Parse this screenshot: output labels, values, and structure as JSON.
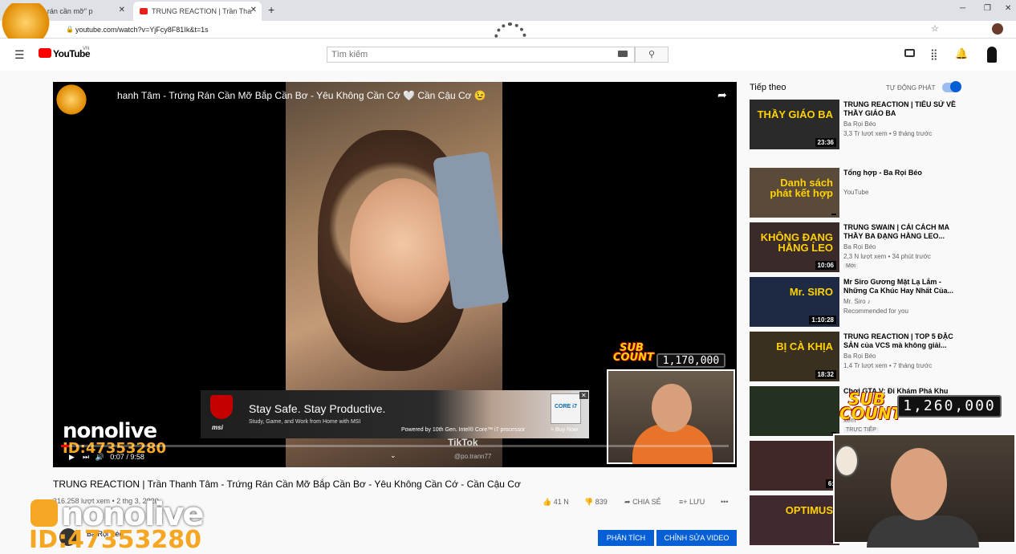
{
  "browser": {
    "tabs": [
      {
        "label": "\"Trứng rán cần mỡ\" p"
      },
      {
        "label": "TRUNG REACTION | Trần Tha"
      }
    ],
    "new_tab": "+",
    "url": "youtube.com/watch?v=YjFcy8F81Ik&t=1s",
    "window_controls": [
      "─",
      "❐",
      "✕"
    ]
  },
  "youtube": {
    "logo": "YouTube",
    "region": "VN",
    "search_placeholder": "Tìm kiếm"
  },
  "video": {
    "overlay_title": "hanh Tâm - Trứng Rán Cần Mỡ Bắp Cần Bơ - Yêu Không Cần Cớ 🤍 Cần Cậu Cơ 😉",
    "time": "0:07 / 9:58",
    "progress_fraction": 0.012,
    "watermark": "@po.trann77",
    "tiktok": "TikTok",
    "nonolive": "nonolive",
    "nonolive_id": "ID:47353280",
    "sub_count_label": "SUB COUNT",
    "sub_count_1": "1,170,000",
    "sub_count_2": "1,260,000",
    "ad": {
      "brand": "msi",
      "headline": "Stay Safe. Stay Productive.",
      "sub": "Study, Game, and Work from Home with MSI",
      "powered": "Powered by 10th Gen. Intel® Core™ i7 processor",
      "cta": "> Buy Now",
      "chip": "CORE i7"
    },
    "title": "TRUNG REACTION | Trần Thanh Tâm - Trứng Rán Cần Mỡ Bắp Cần Bơ - Yêu Không Cần Cớ - Cần Cậu Cơ",
    "views": "316.258 lượt xem • 2 thg 3, 2020",
    "likes": "41 N",
    "dislikes": "839",
    "share": "CHIA SẺ",
    "save": "LƯU",
    "more": "•••",
    "channel": "Ba Rọi Béo",
    "btn_analytics": "PHÂN TÍCH",
    "btn_edit": "CHỈNH SỬA VIDEO"
  },
  "sidebar": {
    "up_next": "Tiếp theo",
    "autoplay": "TỰ ĐỘNG PHÁT",
    "items": [
      {
        "title": "TRUNG REACTION | TIỂU SỬ VỀ THẦY GIÁO BA",
        "channel": "Ba Rọi Béo",
        "meta": "3,3 Tr lượt xem • 9 tháng trước",
        "duration": "23:36",
        "thumb_text": "THẦY GIÁO BA",
        "thumb_color": "#2a2a2a"
      },
      {
        "title": "Tổng hợp - Ba Rọi Béo",
        "channel": "YouTube",
        "meta": "",
        "duration": "",
        "thumb_text": "Danh sách phát kết hợp",
        "thumb_color": "#5a4a3a"
      },
      {
        "title": "TRUNG SWAIN | CẢI CÁCH MA THẦY BA ĐẠNG HẰNG LEO...",
        "channel": "Ba Rọi Béo",
        "meta": "2,3 N lượt xem • 34 phút trước",
        "duration": "10:06",
        "thumb_text": "KHÔNG ĐẠNG HẰNG LEO",
        "badge": "Mới",
        "thumb_color": "#3a2a2a"
      },
      {
        "title": "Mr Siro Gương Mặt Lạ Lắm - Những Ca Khúc Hay Nhất Của...",
        "channel": "Mr. Siro ♪",
        "meta": "Recommended for you",
        "duration": "1:10:28",
        "thumb_text": "Mr. SIRO",
        "thumb_color": "#1e2a44"
      },
      {
        "title": "TRUNG REACTION | TOP 5 ĐẶC SẢN của VCS mà không giải...",
        "channel": "Ba Rọi Béo",
        "meta": "1,4 Tr lượt xem • 7 tháng trước",
        "duration": "18:32",
        "thumb_text": "BỊ CÀ KHỊA",
        "thumb_color": "#3a3020"
      },
      {
        "title": "Chơi GTA V: Đi Khám Phá Khu",
        "channel": "",
        "meta": "xem",
        "duration": "",
        "thumb_text": "",
        "badge": "TRỰC TIẾP",
        "thumb_color": "#243020"
      },
      {
        "title": "",
        "channel": "",
        "meta": "",
        "duration": "6:",
        "thumb_text": "",
        "thumb_color": "#402828"
      },
      {
        "title": "",
        "channel": "",
        "meta": "",
        "duration": "",
        "thumb_text": "OPTIMUS",
        "thumb_color": "#402a30"
      }
    ]
  }
}
